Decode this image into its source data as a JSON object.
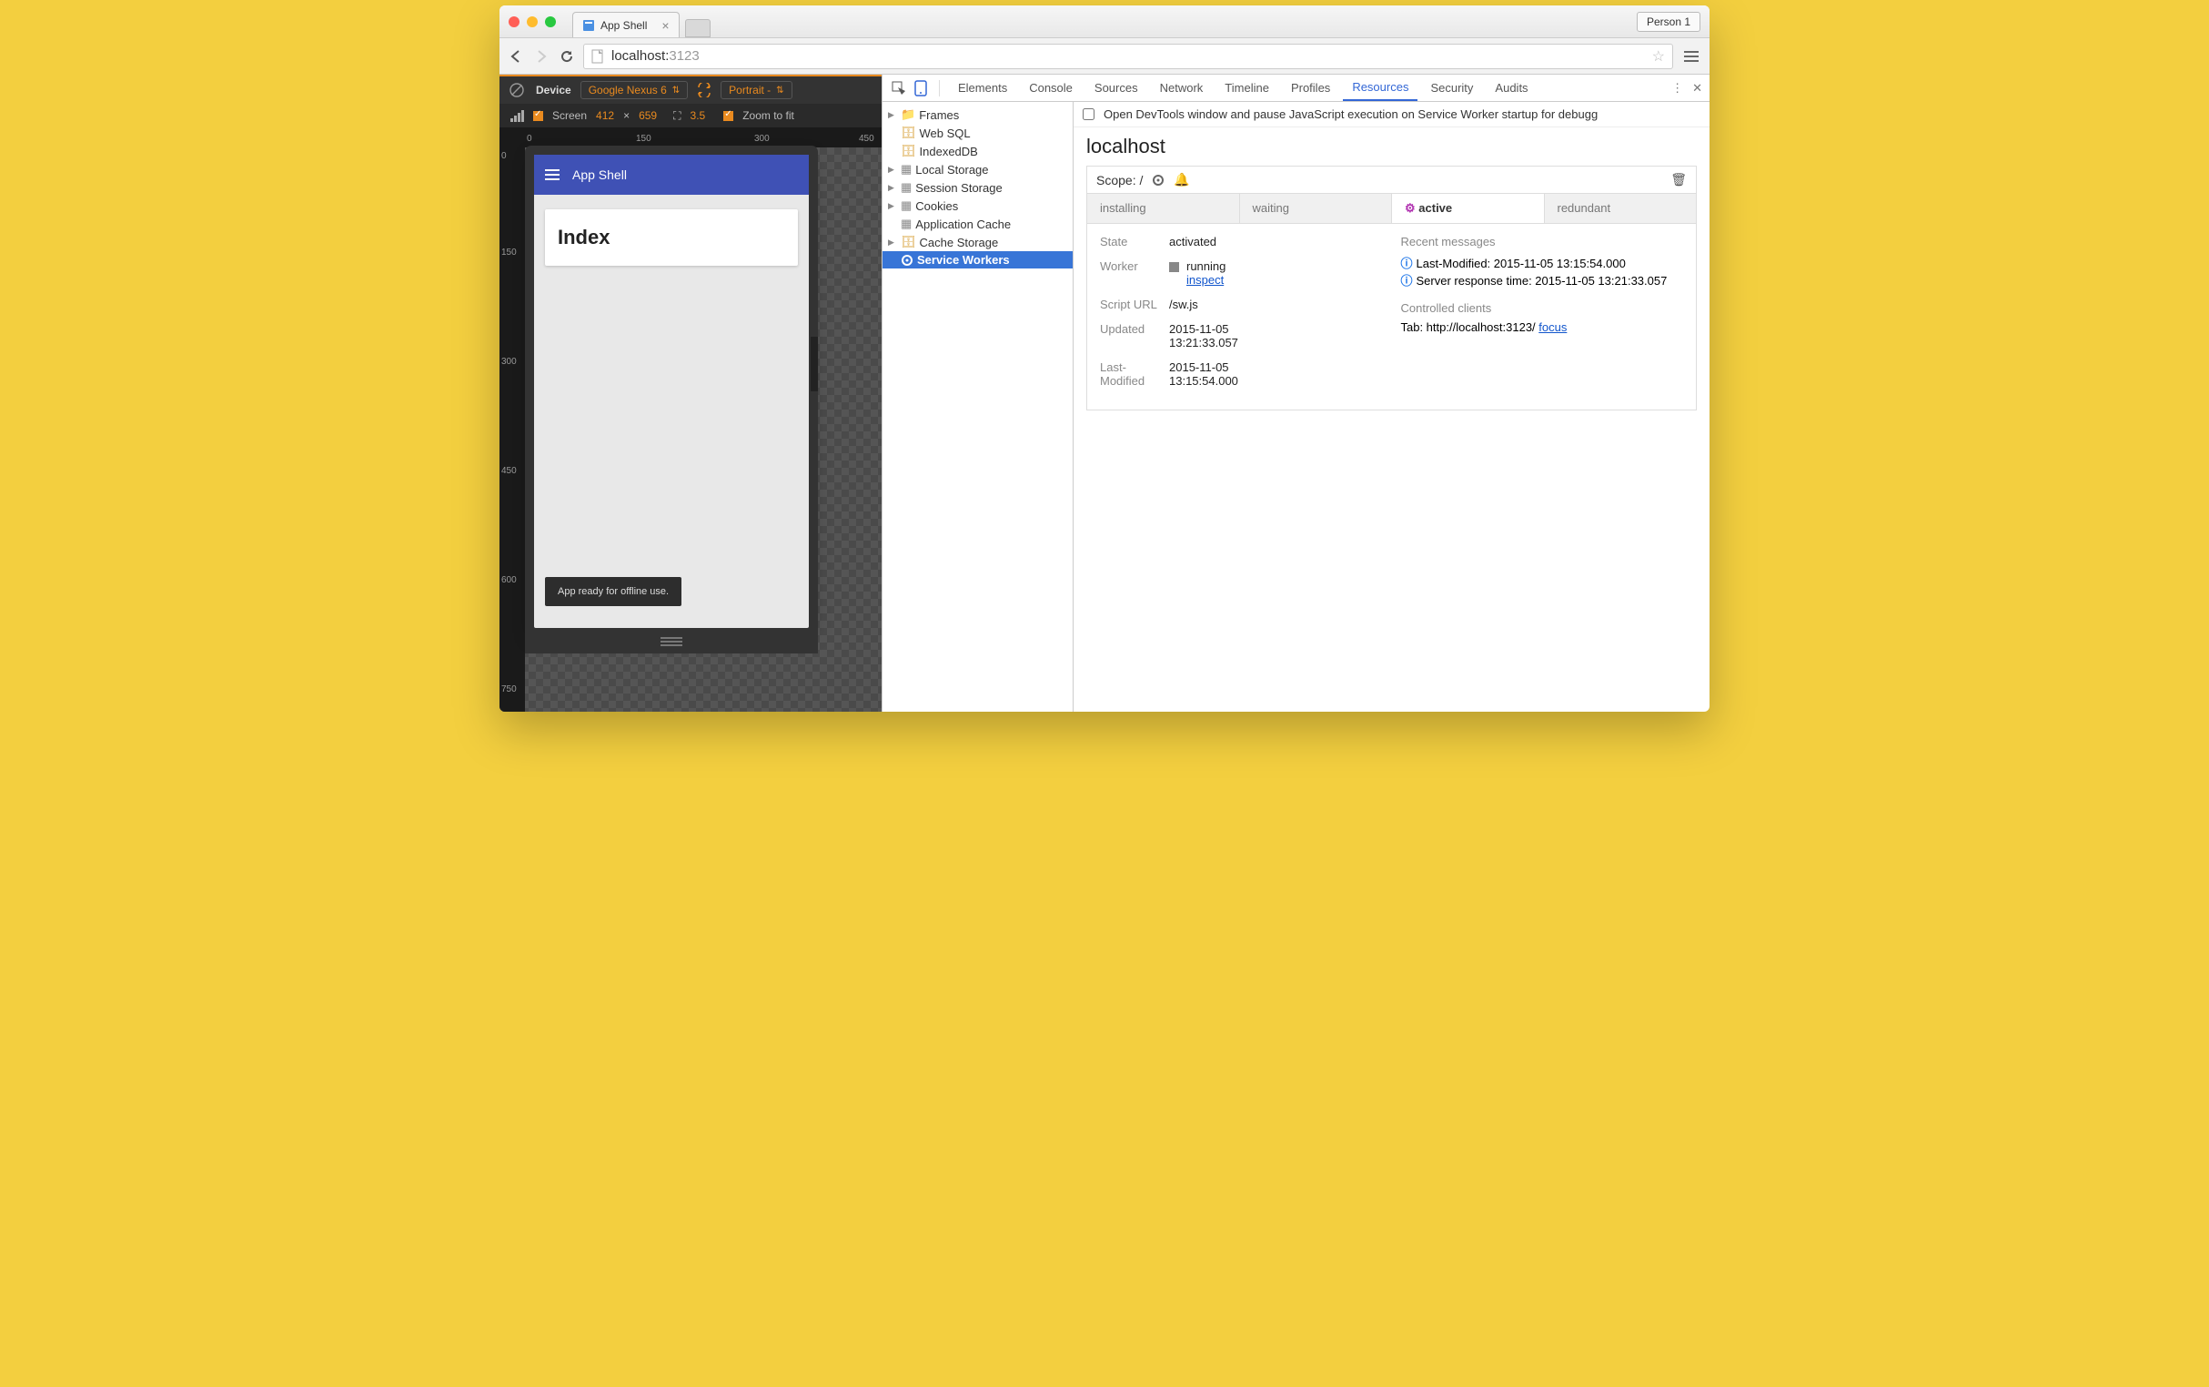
{
  "browser": {
    "tab_title": "App Shell",
    "person": "Person 1",
    "url_host": "localhost:",
    "url_port": "3123"
  },
  "device_toolbar": {
    "device_label": "Device",
    "device_value": "Google Nexus 6",
    "orientation": "Portrait ‑",
    "screen_label": "Screen",
    "width": "412",
    "times": "×",
    "height": "659",
    "dpr": "3.5",
    "zoom_label": "Zoom to fit"
  },
  "ruler_h": {
    "t0": "0",
    "t1": "150",
    "t2": "300",
    "t3": "450"
  },
  "ruler_v": {
    "t0": "0",
    "t1": "150",
    "t2": "300",
    "t3": "450",
    "t4": "600",
    "t5": "750"
  },
  "app": {
    "header": "App Shell",
    "card_title": "Index",
    "toast": "App ready for offline use."
  },
  "devtools": {
    "tabs": {
      "elements": "Elements",
      "console": "Console",
      "sources": "Sources",
      "network": "Network",
      "timeline": "Timeline",
      "profiles": "Profiles",
      "resources": "Resources",
      "security": "Security",
      "audits": "Audits"
    },
    "pause_label": "Open DevTools window and pause JavaScript execution on Service Worker startup for debugg",
    "tree": {
      "frames": "Frames",
      "websql": "Web SQL",
      "indexeddb": "IndexedDB",
      "local": "Local Storage",
      "session": "Session Storage",
      "cookies": "Cookies",
      "appcache": "Application Cache",
      "cachestorage": "Cache Storage",
      "sw": "Service Workers"
    },
    "sw": {
      "origin": "localhost",
      "scope_label": "Scope: /",
      "tabs": {
        "installing": "installing",
        "waiting": "waiting",
        "active": "active",
        "redundant": "redundant"
      },
      "state_k": "State",
      "state_v": "activated",
      "worker_k": "Worker",
      "worker_status": "running",
      "worker_inspect": "inspect",
      "script_k": "Script URL",
      "script_v": "/sw.js",
      "updated_k": "Updated",
      "updated_v1": "2015-11-05",
      "updated_v2": "13:21:33.057",
      "lastmod_k": "Last-Modified",
      "lastmod_v1": "2015-11-05",
      "lastmod_v2": "13:15:54.000",
      "recent": "Recent messages",
      "msg1": "Last-Modified: 2015-11-05 13:15:54.000",
      "msg2": "Server response time: 2015-11-05 13:21:33.057",
      "clients": "Controlled clients",
      "client_tab": "Tab: http://localhost:3123/ ",
      "focus": "focus"
    }
  }
}
